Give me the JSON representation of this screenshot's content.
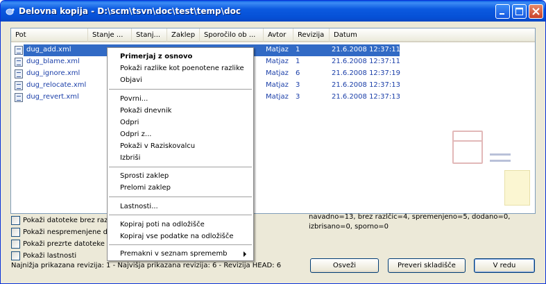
{
  "window": {
    "title": "Delovna kopija - D:\\scm\\tsvn\\doc\\test\\temp\\doc"
  },
  "columns": [
    "Pot",
    "Stanje ...",
    "Stanj...",
    "Zaklep",
    "Sporočilo ob ...",
    "Avtor",
    "Revizija",
    "Datum"
  ],
  "rows": [
    {
      "path": "dug_add.xml",
      "author": "Matjaz",
      "revision": "1",
      "date": "21.6.2008 12:37:11",
      "selected": true
    },
    {
      "path": "dug_blame.xml",
      "author": "Matjaz",
      "revision": "1",
      "date": "21.6.2008 12:37:11",
      "selected": false
    },
    {
      "path": "dug_ignore.xml",
      "author": "Matjaz",
      "revision": "6",
      "date": "21.6.2008 12:37:19",
      "selected": false
    },
    {
      "path": "dug_relocate.xml",
      "author": "Matjaz",
      "revision": "3",
      "date": "21.6.2008 12:37:13",
      "selected": false
    },
    {
      "path": "dug_revert.xml",
      "author": "Matjaz",
      "revision": "3",
      "date": "21.6.2008 12:37:13",
      "selected": false
    }
  ],
  "checkboxes": [
    {
      "label": "Pokaži datoteke brez razli",
      "checked": false
    },
    {
      "label": "Pokaži nespremenjene da",
      "checked": false
    },
    {
      "label": "Pokaži prezrte datoteke",
      "checked": false
    },
    {
      "label": "Pokaži lastnosti",
      "checked": false
    }
  ],
  "stats": {
    "line1": "navadno=13, brez razlčic=4, spremenjeno=5, dodano=0,",
    "line2": "izbrisano=0, sporno=0"
  },
  "footer": "Najnižja prikazana revizija: 1 - Najvišja prikazana revizija: 6 - Revizija HEAD: 6",
  "buttons": {
    "refresh": "Osveži",
    "check_repo": "Preveri skladišče",
    "ok": "V redu"
  },
  "context_menu": {
    "groups": [
      [
        "Primerjaj z osnovo",
        "Pokaži razlike kot poenotene razlike",
        "Objavi"
      ],
      [
        "Povrni...",
        "Pokaži dnevnik",
        "Odpri",
        "Odpri z...",
        "Pokaži v Raziskovalcu",
        "Izbriši"
      ],
      [
        "Sprosti zaklep",
        "Prelomi zaklep"
      ],
      [
        "Lastnosti..."
      ],
      [
        "Kopiraj poti na odložišče",
        "Kopiraj vse podatke na odložišče"
      ],
      [
        "Premakni v seznam sprememb"
      ]
    ]
  }
}
